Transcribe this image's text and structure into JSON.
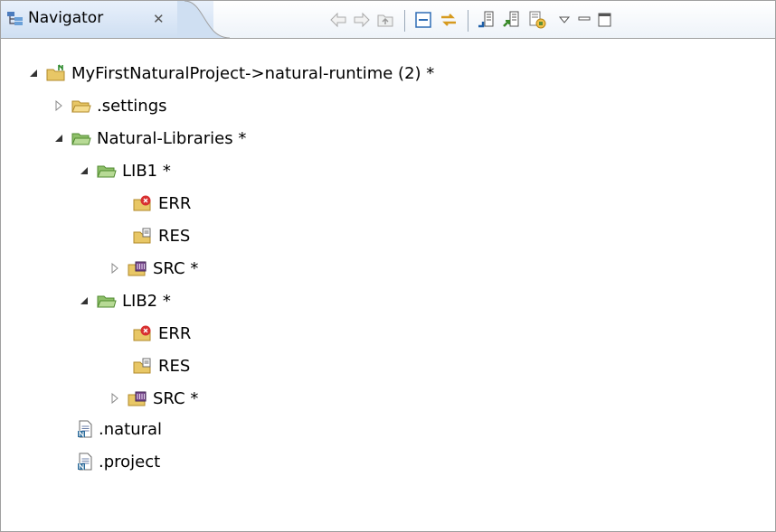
{
  "view": {
    "title": "Navigator",
    "close_glyph": "✕"
  },
  "toolbar": {
    "buttons": [
      "back-icon",
      "forward-icon",
      "up-icon",
      "collapse-all-icon",
      "link-with-editor-icon",
      "download-icon",
      "upload-icon",
      "synchronize-icon",
      "view-menu-icon",
      "minimize-icon",
      "maximize-icon"
    ]
  },
  "tree": {
    "project": "MyFirstNaturalProject->natural-runtime (2) *",
    "settings": ".settings",
    "libraries": "Natural-Libraries *",
    "lib1": {
      "label": "LIB1 *",
      "err": "ERR",
      "res": "RES",
      "src": "SRC *"
    },
    "lib2": {
      "label": "LIB2 *",
      "err": "ERR",
      "res": "RES",
      "src": "SRC *"
    },
    "natural_file": ".natural",
    "project_file": ".project"
  },
  "colors": {
    "folder": "#e8c766",
    "folder_dark": "#b18a2a",
    "green_folder": "#8fc06a",
    "error_red": "#d83030",
    "tab_blue": "#d6e4f5"
  }
}
